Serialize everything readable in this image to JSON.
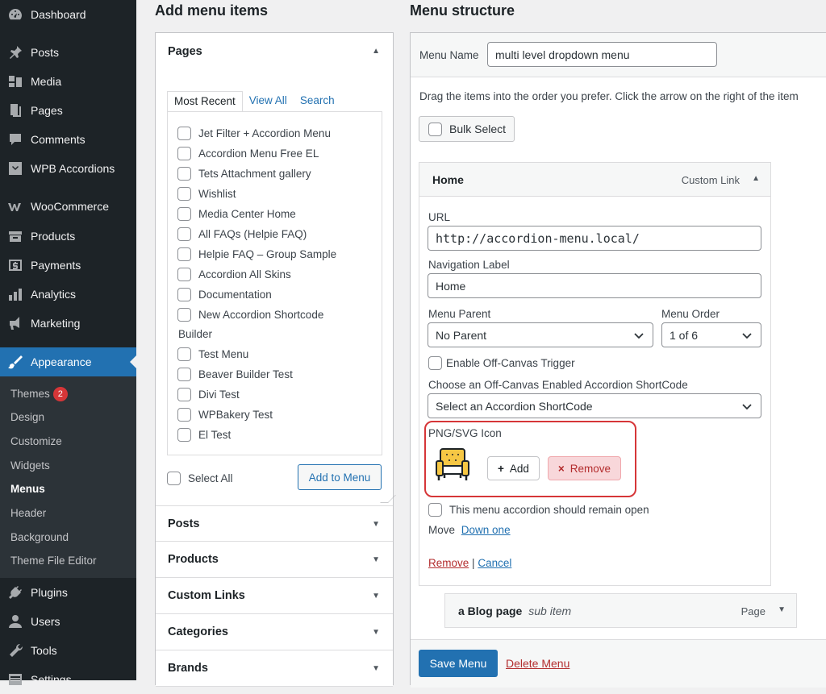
{
  "sidebar": {
    "items": [
      {
        "label": "Dashboard",
        "icon": "dashboard-icon"
      },
      {
        "label": "Posts",
        "icon": "pin-icon"
      },
      {
        "label": "Media",
        "icon": "media-icon"
      },
      {
        "label": "Pages",
        "icon": "pages-icon"
      },
      {
        "label": "Comments",
        "icon": "comment-icon"
      },
      {
        "label": "WPB Accordions",
        "icon": "accordion-icon"
      },
      {
        "label": "WooCommerce",
        "icon": "woocommerce-icon"
      },
      {
        "label": "Products",
        "icon": "archive-icon"
      },
      {
        "label": "Payments",
        "icon": "dollar-icon"
      },
      {
        "label": "Analytics",
        "icon": "bar-chart-icon"
      },
      {
        "label": "Marketing",
        "icon": "megaphone-icon"
      },
      {
        "label": "Appearance",
        "icon": "paintbrush-icon"
      },
      {
        "label": "Plugins",
        "icon": "plug-icon"
      },
      {
        "label": "Users",
        "icon": "user-icon"
      },
      {
        "label": "Tools",
        "icon": "wrench-icon"
      },
      {
        "label": "Settings",
        "icon": "settings-icon"
      }
    ],
    "submenu": [
      "Themes",
      "Design",
      "Customize",
      "Widgets",
      "Menus",
      "Header",
      "Background",
      "Theme File Editor"
    ],
    "themes_badge": "2"
  },
  "add_items": {
    "heading": "Add menu items",
    "pages_section": "Pages",
    "tabs": [
      "Most Recent",
      "View All",
      "Search"
    ],
    "pages": [
      "Jet Filter + Accordion Menu",
      "Accordion Menu Free EL",
      "Tets Attachment gallery",
      "Wishlist",
      "Media Center Home",
      "All FAQs (Helpie FAQ)",
      "Helpie FAQ – Group Sample",
      "Accordion All Skins",
      "Documentation",
      "New Accordion Shortcode",
      "Test Menu",
      "Beaver Builder Test",
      "Divi Test",
      "WPBakery Test",
      "El Test"
    ],
    "pages_wrap": "Builder",
    "select_all": "Select All",
    "add_to_menu": "Add to Menu",
    "sections": [
      "Posts",
      "Products",
      "Custom Links",
      "Categories",
      "Brands"
    ]
  },
  "structure": {
    "heading": "Menu structure",
    "menu_name_label": "Menu Name",
    "menu_name_value": "multi level dropdown menu",
    "instructions": "Drag the items into the order you prefer. Click the arrow on the right of the item",
    "bulk_select": "Bulk Select",
    "item": {
      "title": "Home",
      "type": "Custom Link",
      "url_label": "URL",
      "url_value": "http://accordion-menu.local/",
      "nav_label_label": "Navigation Label",
      "nav_label_value": "Home",
      "parent_label": "Menu Parent",
      "parent_value": "No Parent",
      "order_label": "Menu Order",
      "order_value": "1 of 6",
      "offcanvas_label": "Enable Off-Canvas Trigger",
      "shortcode_label": "Choose an Off-Canvas Enabled Accordion ShortCode",
      "shortcode_value": "Select an Accordion ShortCode",
      "icon_label": "PNG/SVG Icon",
      "add_label": "Add",
      "remove_label": "Remove",
      "remain_open_label": "This menu accordion should remain open",
      "move_label": "Move",
      "move_link": "Down one",
      "remove_link": "Remove",
      "separator": "|",
      "cancel_link": "Cancel"
    },
    "sub_item": {
      "title": "a Blog page",
      "subtitle": "sub item",
      "type": "Page"
    },
    "save_menu": "Save Menu",
    "delete_menu": "Delete Menu"
  },
  "colors": {
    "accent": "#2271b1",
    "sidebar": "#1d2327",
    "highlight_border": "#d63638",
    "remove_bg": "#f8d7da"
  }
}
